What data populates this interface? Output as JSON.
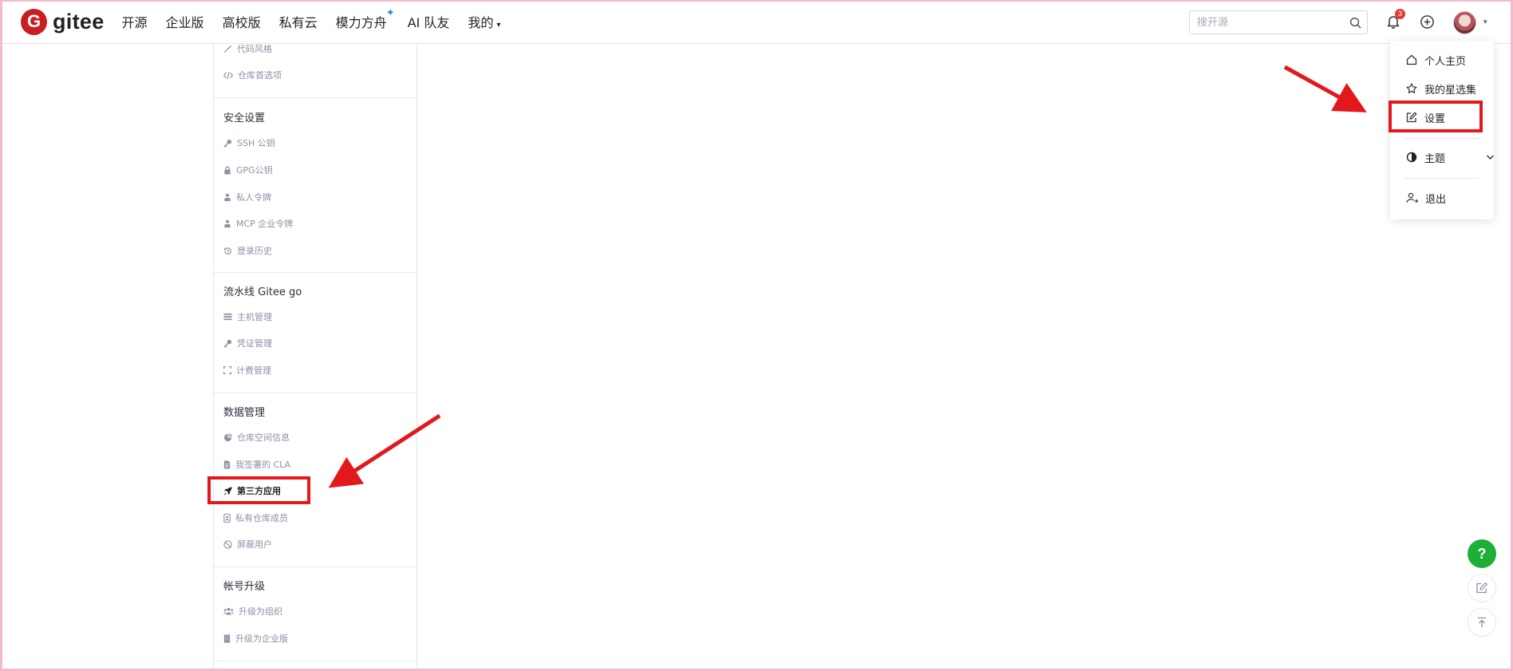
{
  "brand": {
    "logo_letter": "G",
    "name": "gitee",
    "color": "#c71d23"
  },
  "nav": [
    {
      "label": "开源"
    },
    {
      "label": "企业版"
    },
    {
      "label": "高校版"
    },
    {
      "label": "私有云"
    },
    {
      "label": "模力方舟",
      "spark": "✦"
    },
    {
      "label": "AI 队友"
    },
    {
      "label": "我的",
      "caret": "▾"
    }
  ],
  "header": {
    "search_placeholder": "搜开源",
    "notification_count": "3",
    "avatar_caret": "▾"
  },
  "sidebar": {
    "top_items": [
      {
        "label": "代码风格",
        "icon": "brush-icon"
      },
      {
        "label": "仓库首选项",
        "icon": "code-icon"
      }
    ],
    "sections": [
      {
        "heading": "安全设置",
        "items": [
          {
            "label": "SSH 公钥",
            "icon": "key-icon"
          },
          {
            "label": "GPG公钥",
            "icon": "lock-icon"
          },
          {
            "label": "私人令牌",
            "icon": "token-icon"
          },
          {
            "label": "MCP 企业令牌",
            "icon": "token-icon"
          },
          {
            "label": "登录历史",
            "icon": "history-icon"
          }
        ]
      },
      {
        "heading": "流水线 Gitee go",
        "items": [
          {
            "label": "主机管理",
            "icon": "server-icon"
          },
          {
            "label": "凭证管理",
            "icon": "key-icon"
          },
          {
            "label": "计费管理",
            "icon": "billing-icon"
          }
        ]
      },
      {
        "heading": "数据管理",
        "items": [
          {
            "label": "仓库空间信息",
            "icon": "pie-icon"
          },
          {
            "label": "我签署的 CLA",
            "icon": "file-icon"
          },
          {
            "label": "第三方应用",
            "icon": "rocket-icon",
            "active": true
          },
          {
            "label": "私有仓库成员",
            "icon": "member-icon"
          },
          {
            "label": "屏蔽用户",
            "icon": "block-icon"
          }
        ]
      },
      {
        "heading": "帐号升级",
        "items": [
          {
            "label": "升级为组织",
            "icon": "group-icon"
          },
          {
            "label": "升级为企业版",
            "icon": "building-icon"
          }
        ]
      }
    ]
  },
  "user_menu": {
    "items": [
      {
        "label": "个人主页",
        "icon": "home-icon"
      },
      {
        "label": "我的星选集",
        "icon": "star-icon"
      },
      {
        "label": "设置",
        "icon": "edit-icon"
      },
      {
        "label": "主题",
        "icon": "contrast-icon"
      },
      {
        "label": "退出",
        "icon": "logout-icon"
      }
    ]
  },
  "floating": {
    "help_label": "?"
  },
  "colors": {
    "annotation": "#e3181d",
    "help_button": "#1eaf36",
    "badge": "#e53935",
    "frame": "#f4b8cf"
  }
}
